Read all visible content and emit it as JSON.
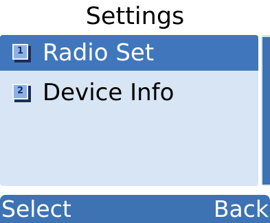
{
  "screen": {
    "title": "Settings"
  },
  "menu": {
    "items": [
      {
        "number": "1",
        "label": "Radio Set",
        "selected": true,
        "icon": "number-1-icon"
      },
      {
        "number": "2",
        "label": "Device Info",
        "selected": false,
        "icon": "number-2-icon"
      }
    ]
  },
  "softkeys": {
    "left_label": "Select",
    "right_label": "Back"
  },
  "colors": {
    "selection": "#4077bc",
    "panel": "#d7e5f4",
    "softkey_bar": "#3d73b3",
    "icon_face": "#8cb1e6",
    "icon_shadow": "#1c2b5c"
  }
}
